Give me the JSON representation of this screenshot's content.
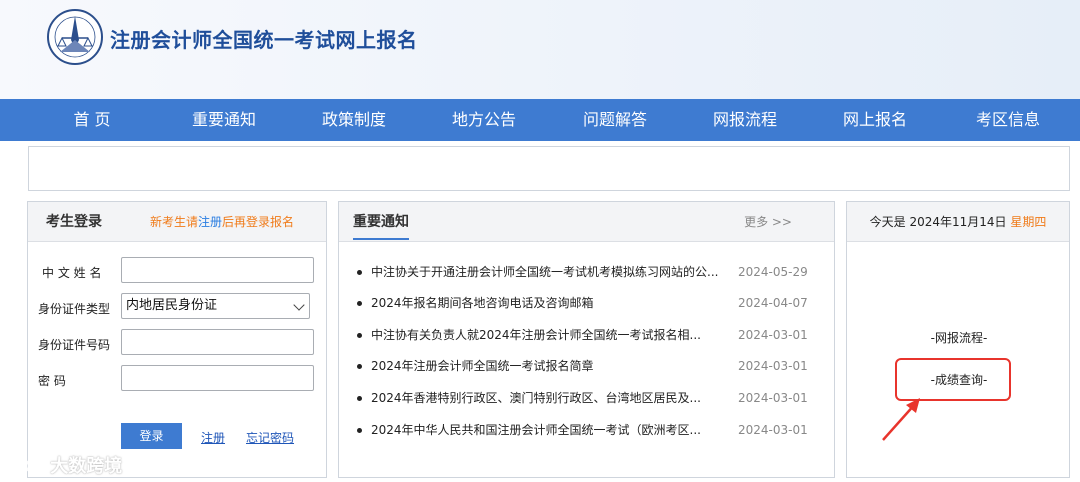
{
  "header": {
    "title": "注册会计师全国统一考试网上报名"
  },
  "nav": {
    "items": [
      "首 页",
      "重要通知",
      "政策制度",
      "地方公告",
      "问题解答",
      "网报流程",
      "网上报名",
      "考区信息"
    ]
  },
  "login": {
    "title": "考生登录",
    "tip_prefix": "新考生请",
    "tip_link": "注册",
    "tip_suffix": "后再登录报名",
    "labels": {
      "name": "中 文  姓 名",
      "id_type": "身份证件类型",
      "id_number": "身份证件号码",
      "password": "密         码"
    },
    "id_type_value": "内地居民身份证",
    "login_button": "登录",
    "register_link": "注册",
    "forgot_link": "忘记密码"
  },
  "notices": {
    "title": "重要通知",
    "more": "更多 >>",
    "items": [
      {
        "title": "中注协关于开通注册会计师全国统一考试机考模拟练习网站的公...",
        "date": "2024-05-29"
      },
      {
        "title": "2024年报名期间各地咨询电话及咨询邮箱",
        "date": "2024-04-07"
      },
      {
        "title": "中注协有关负责人就2024年注册会计师全国统一考试报名相...",
        "date": "2024-03-01"
      },
      {
        "title": "2024年注册会计师全国统一考试报名简章",
        "date": "2024-03-01"
      },
      {
        "title": "2024年香港特别行政区、澳门特别行政区、台湾地区居民及...",
        "date": "2024-03-01"
      },
      {
        "title": "2024年中华人民共和国注册会计师全国统一考试（欧洲考区...",
        "date": "2024-03-01"
      }
    ]
  },
  "side": {
    "date_prefix": "今天是 2024年11月14日",
    "weekday": "星期四",
    "process_link": "-网报流程-",
    "score_link": "-成绩查询-"
  },
  "watermark": {
    "text": "大数跨境"
  },
  "colors": {
    "nav_blue": "#3e7bd1",
    "title_blue": "#1f4e9a",
    "orange": "#f07b1a",
    "annotation_red": "#e8342c"
  }
}
